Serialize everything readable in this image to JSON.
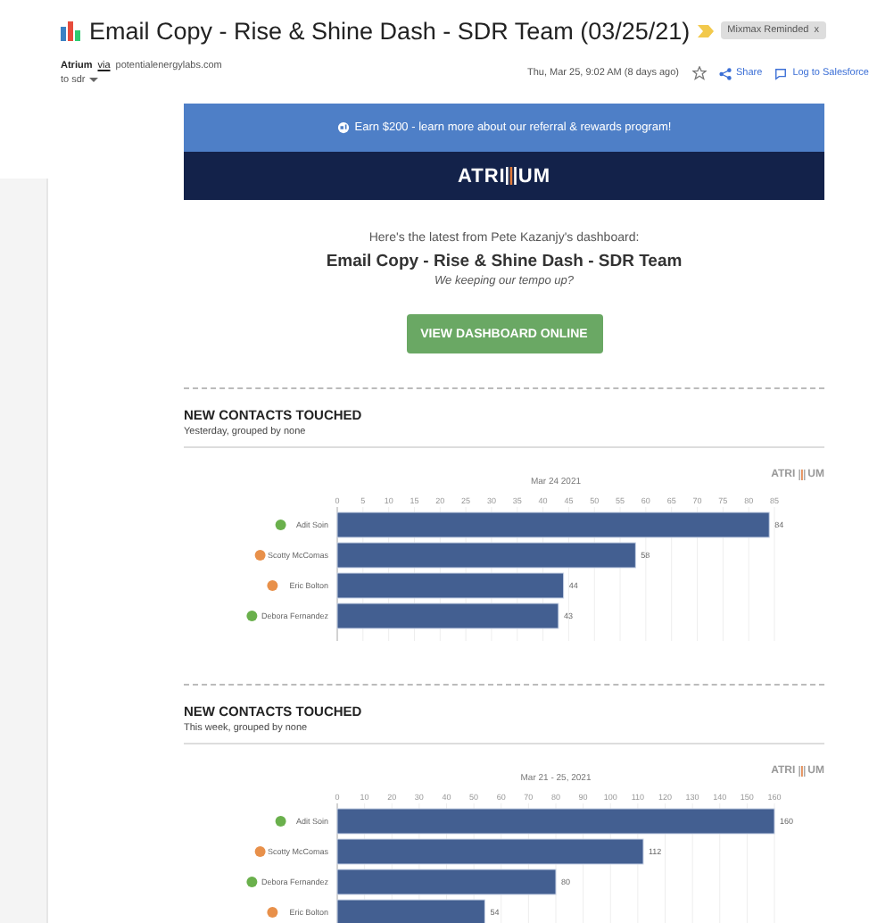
{
  "subject": {
    "title": "Email Copy - Rise & Shine Dash - SDR Team (03/25/21)",
    "label": "Mixmax Reminded",
    "label_close": "x"
  },
  "sender": {
    "name": "Atrium",
    "via": "via",
    "domain": "potentialenergylabs.com",
    "to": "to sdr",
    "date": "Thu, Mar 25, 9:02 AM (8 days ago)",
    "share": "Share",
    "log": "Log to Salesforce"
  },
  "email": {
    "banner": "Earn $200 - learn more about our referral & rewards program!",
    "logo_left": "ATRI",
    "logo_right": "UM",
    "intro": "Here's the latest from Pete Kazanjy's dashboard:",
    "title": "Email Copy - Rise & Shine Dash - SDR Team",
    "tagline": "We keeping our tempo up?",
    "button": "VIEW DASHBOARD ONLINE"
  },
  "sections": [
    {
      "heading": "NEW CONTACTS TOUCHED",
      "subheading": "Yesterday, grouped by none",
      "chart_brand_left": "ATRI",
      "chart_brand_right": "UM",
      "rows": [
        {
          "color": "#6ab04c"
        },
        {
          "color": "#e8904a"
        },
        {
          "color": "#e8904a"
        },
        {
          "color": "#6ab04c"
        }
      ],
      "chart_data": {
        "type": "bar",
        "orientation": "horizontal",
        "title": "Mar 24 2021",
        "categories": [
          "Adit Soin",
          "Scotty McComas",
          "Eric Bolton",
          "Debora Fernandez"
        ],
        "values": [
          84,
          58,
          44,
          43
        ],
        "xlim": [
          0,
          85
        ],
        "xticks": [
          0,
          5,
          10,
          15,
          20,
          25,
          30,
          35,
          40,
          45,
          50,
          55,
          60,
          65,
          70,
          75,
          80,
          85
        ],
        "grid": true,
        "data_labels": true
      }
    },
    {
      "heading": "NEW CONTACTS TOUCHED",
      "subheading": "This week, grouped by none",
      "chart_brand_left": "ATRI",
      "chart_brand_right": "UM",
      "rows": [
        {
          "color": "#6ab04c"
        },
        {
          "color": "#e8904a"
        },
        {
          "color": "#6ab04c"
        },
        {
          "color": "#e8904a"
        }
      ],
      "chart_data": {
        "type": "bar",
        "orientation": "horizontal",
        "title": "Mar 21 - 25, 2021",
        "categories": [
          "Adit Soin",
          "Scotty McComas",
          "Debora Fernandez",
          "Eric Bolton"
        ],
        "values": [
          160,
          112,
          80,
          54
        ],
        "xlim": [
          0,
          160
        ],
        "xticks": [
          0,
          10,
          20,
          30,
          40,
          50,
          60,
          70,
          80,
          90,
          100,
          110,
          120,
          130,
          140,
          150,
          160
        ],
        "grid": true,
        "data_labels": true
      }
    }
  ]
}
